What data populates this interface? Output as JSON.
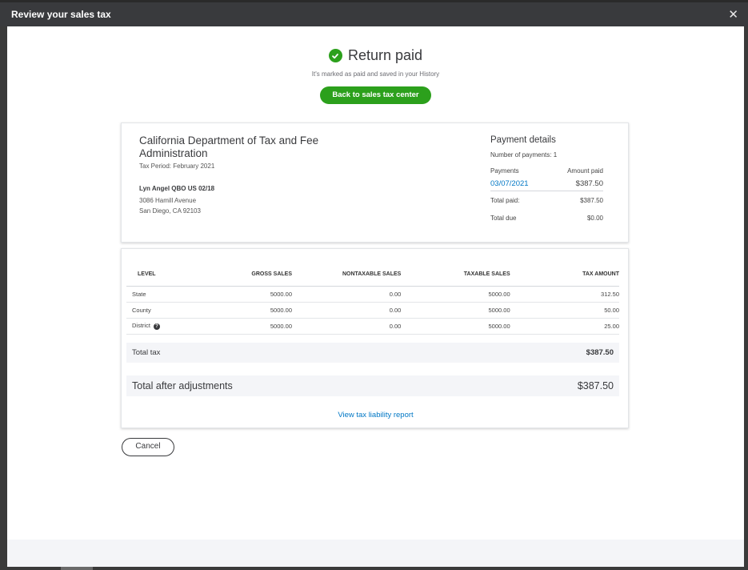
{
  "window": {
    "title": "Review your sales tax"
  },
  "hero": {
    "title": "Return paid",
    "subtitle": "It's marked as paid and saved in your History",
    "back_button": "Back to sales tax center"
  },
  "filing": {
    "agency": "California Department of Tax and Fee Administration",
    "tax_period": "Tax Period: February 2021",
    "company": "Lyn Angel QBO US 02/18",
    "address_line1": "3086 Hamill Avenue",
    "address_line2": "San Diego, CA 92103"
  },
  "payment_details": {
    "title": "Payment details",
    "num_payments": "Number of payments: 1",
    "col_payments": "Payments",
    "col_amount": "Amount paid",
    "payment_date": "03/07/2021",
    "payment_amount": "$387.50",
    "total_paid_label": "Total paid:",
    "total_paid": "$387.50",
    "total_due_label": "Total due",
    "total_due": "$0.00"
  },
  "table": {
    "headers": [
      "LEVEL",
      "GROSS SALES",
      "NONTAXABLE SALES",
      "TAXABLE SALES",
      "TAX AMOUNT"
    ],
    "rows": [
      {
        "level": "State",
        "gross": "5000.00",
        "nontaxable": "0.00",
        "taxable": "5000.00",
        "tax": "312.50"
      },
      {
        "level": "County",
        "gross": "5000.00",
        "nontaxable": "0.00",
        "taxable": "5000.00",
        "tax": "50.00"
      },
      {
        "level": "District",
        "gross": "5000.00",
        "nontaxable": "0.00",
        "taxable": "5000.00",
        "tax": "25.00"
      }
    ]
  },
  "totals": {
    "total_tax_label": "Total tax",
    "total_tax": "$387.50",
    "after_adjustments_label": "Total after adjustments",
    "after_adjustments": "$387.50",
    "report_link": "View tax liability report"
  },
  "actions": {
    "cancel": "Cancel"
  },
  "icons": {
    "success": "check-circle-icon",
    "help": "question-circle-icon",
    "close": "close-icon"
  },
  "colors": {
    "accent_green": "#2ca01c",
    "link_blue": "#0077c5",
    "titlebar": "#393a3d"
  }
}
